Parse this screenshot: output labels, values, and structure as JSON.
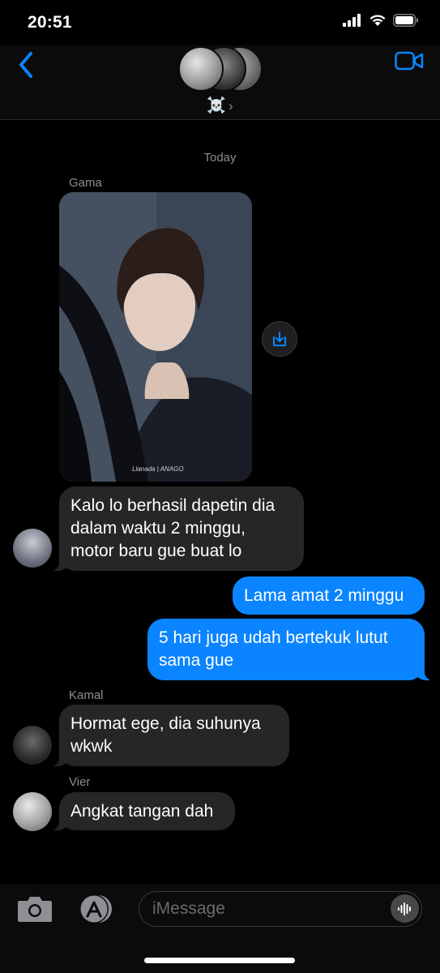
{
  "status": {
    "time": "20:51"
  },
  "header": {
    "group_name": "☠️",
    "chevron": "›",
    "icons": [
      "back-chevron-icon",
      "video-camera-icon"
    ]
  },
  "chat": {
    "date_label": "Today",
    "messages": [
      {
        "sender": "Gama",
        "direction": "incoming",
        "type": "photo",
        "photo_caption": "Llanada | ANAGO"
      },
      {
        "sender": "Gama",
        "direction": "incoming",
        "type": "text",
        "text": "Kalo lo berhasil dapetin dia dalam waktu 2 minggu, motor baru gue buat lo"
      },
      {
        "direction": "outgoing",
        "type": "text",
        "text": "Lama amat 2 minggu"
      },
      {
        "direction": "outgoing",
        "type": "text",
        "text": "5 hari juga udah bertekuk lutut sama gue"
      },
      {
        "sender": "Kamal",
        "direction": "incoming",
        "type": "text",
        "text": "Hormat ege, dia suhunya wkwk"
      },
      {
        "sender": "Vier",
        "direction": "incoming",
        "type": "text",
        "text": "Angkat tangan dah"
      }
    ]
  },
  "input": {
    "placeholder": "iMessage",
    "icons": [
      "camera-icon",
      "app-store-icon",
      "audio-waveform-icon"
    ]
  },
  "colors": {
    "background": "#000000",
    "incoming_bubble": "#262628",
    "outgoing_bubble": "#0a84ff",
    "accent": "#0a84ff",
    "meta_text": "#8e8e93"
  }
}
